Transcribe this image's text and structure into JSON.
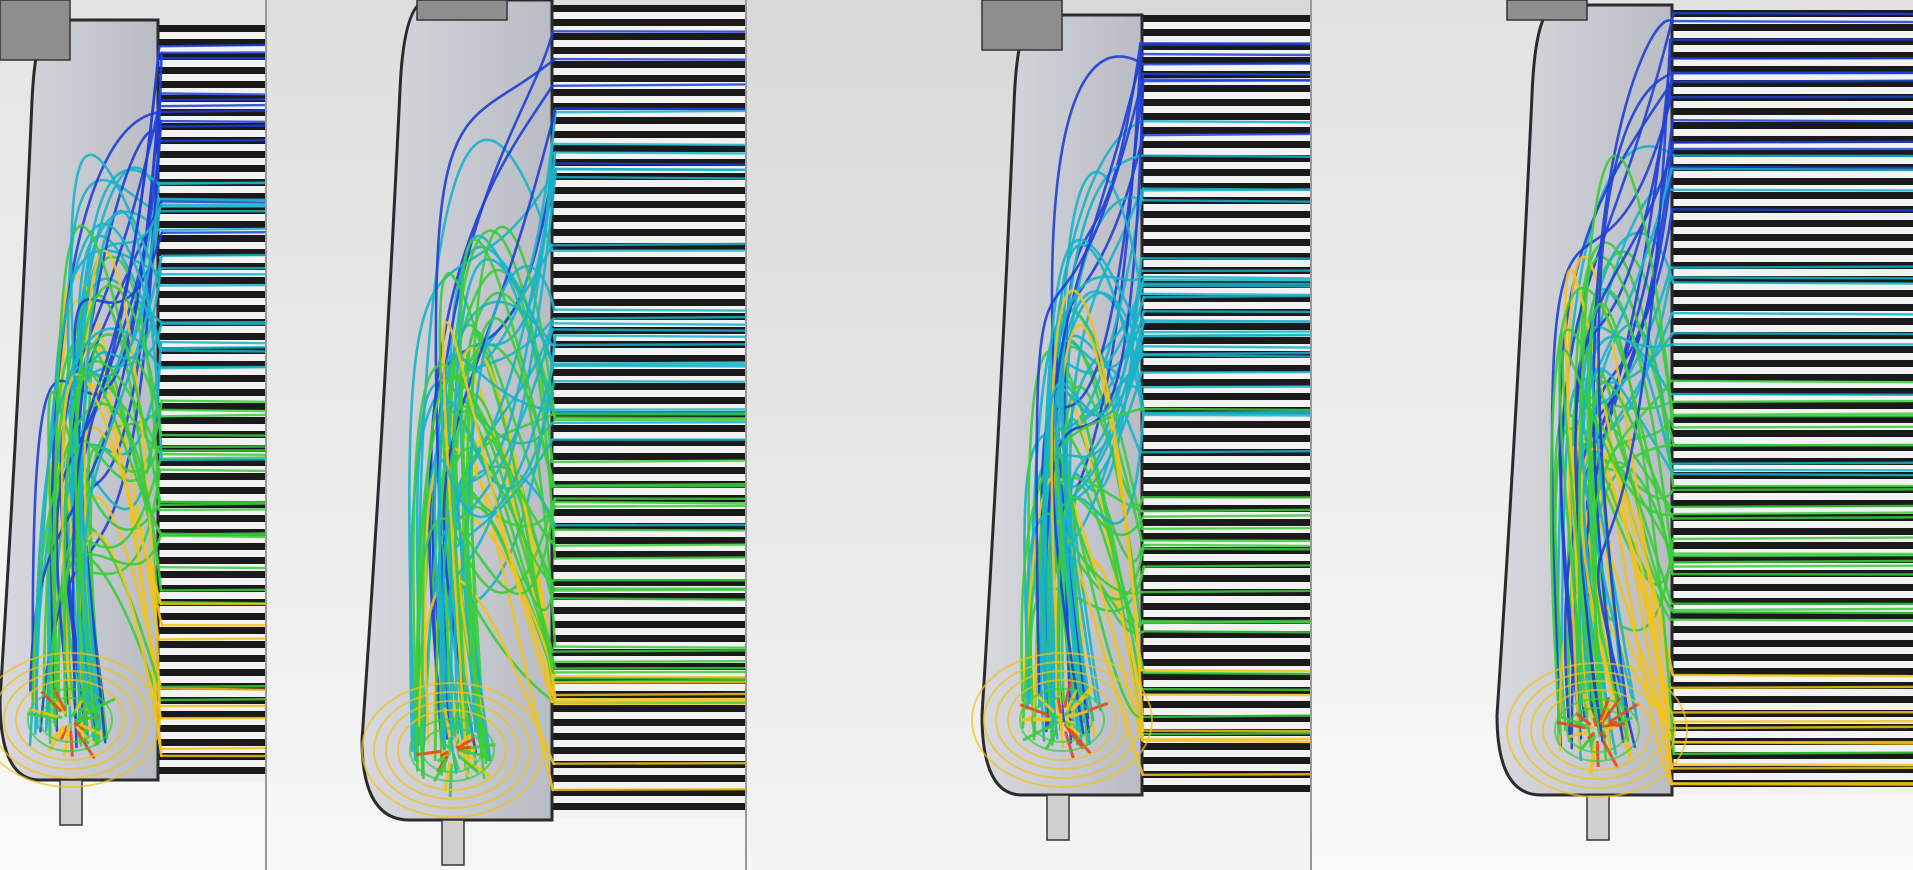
{
  "image": {
    "description_hidden": "",
    "panels": [
      {
        "id": "design-1",
        "colors": {
          "bg_top": "#e4e4e4",
          "bg_bottom": "#fafafa"
        }
      },
      {
        "id": "design-2",
        "colors": {
          "bg_top": "#dedede",
          "bg_bottom": "#f7f7f7"
        }
      },
      {
        "id": "design-3",
        "colors": {
          "bg_top": "#d8d8d8",
          "bg_bottom": "#f4f4f4"
        }
      },
      {
        "id": "design-4",
        "colors": {
          "bg_top": "#e2e2e2",
          "bg_bottom": "#f9f9f9"
        }
      }
    ],
    "palette": {
      "housing_fill": "#b9bcc4",
      "housing_edge": "#2b2b2b",
      "fin_dark": "#1a1a1a",
      "fin_light": "#f2f2f2",
      "flow_low": "#1f3fd6",
      "flow_mid": "#19b3c9",
      "flow_high": "#3bcc3b",
      "flow_peak": "#f2c21b",
      "flow_hot": "#e64a19"
    }
  }
}
